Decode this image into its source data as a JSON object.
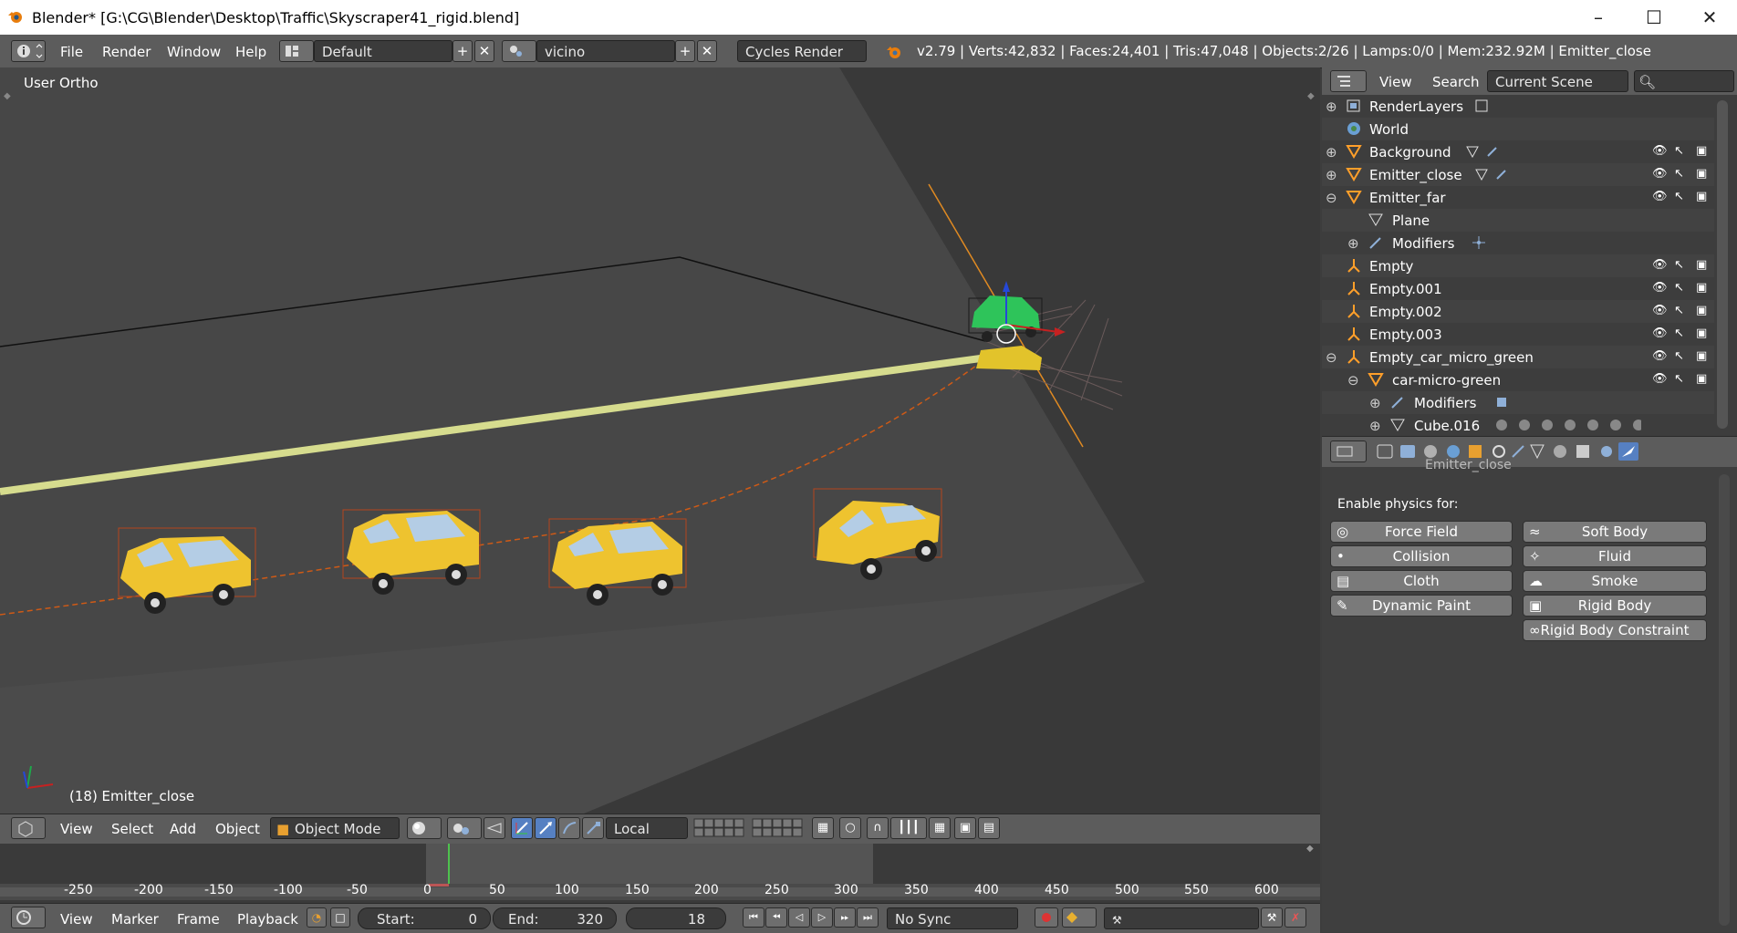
{
  "window": {
    "title": "Blender* [G:\\CG\\Blender\\Desktop\\Traffic\\Skyscraper41_rigid.blend]"
  },
  "info_header": {
    "menus": [
      "File",
      "Render",
      "Window",
      "Help"
    ],
    "layout_value": "Default",
    "scene_value": "vicino",
    "engine_value": "Cycles Render",
    "stats": "v2.79 | Verts:42,832 | Faces:24,401 | Tris:47,048 | Objects:2/26 | Lamps:0/0 | Mem:232.92M | Emitter_close"
  },
  "viewport": {
    "view_label": "User Ortho",
    "object_label": "(18) Emitter_close"
  },
  "outliner": {
    "menu_view": "View",
    "menu_search": "Search",
    "display_mode": "Current Scene",
    "rows": [
      {
        "label": "RenderLayers",
        "icon": "renderlayers-icon"
      },
      {
        "label": "World",
        "icon": "world-icon"
      },
      {
        "label": "Background",
        "icon": "mesh-icon"
      },
      {
        "label": "Emitter_close",
        "icon": "mesh-icon"
      },
      {
        "label": "Emitter_far",
        "icon": "mesh-icon"
      },
      {
        "label": "Plane",
        "icon": "mesh-data-icon"
      },
      {
        "label": "Modifiers",
        "icon": "wrench-icon"
      },
      {
        "label": "Empty",
        "icon": "empty-icon"
      },
      {
        "label": "Empty.001",
        "icon": "empty-icon"
      },
      {
        "label": "Empty.002",
        "icon": "empty-icon"
      },
      {
        "label": "Empty.003",
        "icon": "empty-icon"
      },
      {
        "label": "Empty_car_micro_green",
        "icon": "empty-icon"
      },
      {
        "label": "car-micro-green",
        "icon": "mesh-icon"
      },
      {
        "label": "Modifiers",
        "icon": "wrench-icon"
      },
      {
        "label": "Cube.016",
        "icon": "mesh-data-icon"
      }
    ]
  },
  "properties": {
    "partial_label": "Emitter_close",
    "section_title": "Enable physics for:",
    "buttons_left": [
      "Force Field",
      "Collision",
      "Cloth",
      "Dynamic Paint"
    ],
    "buttons_right": [
      "Soft Body",
      "Fluid",
      "Smoke",
      "Rigid Body",
      "Rigid Body Constraint"
    ]
  },
  "view3d_header": {
    "menus": [
      "View",
      "Select",
      "Add",
      "Object"
    ],
    "mode_value": "Object Mode",
    "orientation_value": "Local"
  },
  "timeline": {
    "ticks": [
      "-250",
      "-200",
      "-150",
      "-100",
      "-50",
      "0",
      "50",
      "100",
      "150",
      "200",
      "250",
      "300",
      "350",
      "400",
      "450",
      "500",
      "550",
      "600"
    ],
    "menus": [
      "View",
      "Marker",
      "Frame",
      "Playback"
    ],
    "start_label": "Start:",
    "start_value": "0",
    "end_label": "End:",
    "end_value": "320",
    "current_frame": "18",
    "sync_value": "No Sync"
  },
  "colors": {
    "accent_blue": "#5680c2",
    "selected_text": "#ffffff",
    "active_object": "#ff9f2a",
    "car_yellow": "#f0c419"
  }
}
